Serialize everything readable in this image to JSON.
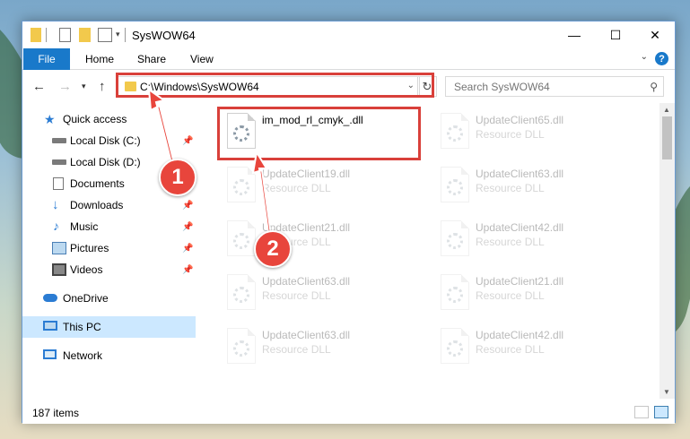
{
  "window": {
    "title": "SysWOW64",
    "controls": {
      "minimize": "—",
      "maximize": "☐",
      "close": "✕"
    }
  },
  "ribbon": {
    "tabs": [
      "File",
      "Home",
      "Share",
      "View"
    ],
    "help": "?"
  },
  "address_bar": {
    "path": "C:\\Windows\\SysWOW64"
  },
  "search": {
    "placeholder": "Search SysWOW64"
  },
  "sidebar": {
    "items": [
      {
        "label": "Quick access",
        "icon": "star-icon",
        "pinned": false
      },
      {
        "label": "Local Disk (C:)",
        "icon": "drive-icon",
        "pinned": true
      },
      {
        "label": "Local Disk (D:)",
        "icon": "drive-icon",
        "pinned": true
      },
      {
        "label": "Documents",
        "icon": "documents-icon",
        "pinned": true
      },
      {
        "label": "Downloads",
        "icon": "download-icon",
        "pinned": true
      },
      {
        "label": "Music",
        "icon": "music-icon",
        "pinned": true
      },
      {
        "label": "Pictures",
        "icon": "pictures-icon",
        "pinned": true
      },
      {
        "label": "Videos",
        "icon": "videos-icon",
        "pinned": true
      },
      {
        "label": "OneDrive",
        "icon": "cloud-icon",
        "pinned": false
      },
      {
        "label": "This PC",
        "icon": "computer-icon",
        "pinned": false,
        "selected": true
      },
      {
        "label": "Network",
        "icon": "network-icon",
        "pinned": false
      }
    ]
  },
  "files": [
    {
      "name": "im_mod_rl_cmyk_.dll",
      "type": "",
      "highlighted": true
    },
    {
      "name": "UpdateClient65.dll",
      "type": "Resource DLL"
    },
    {
      "name": "UpdateClient19.dll",
      "type": "Resource DLL"
    },
    {
      "name": "UpdateClient63.dll",
      "type": "Resource DLL"
    },
    {
      "name": "UpdateClient21.dll",
      "type": "Resource DLL"
    },
    {
      "name": "UpdateClient42.dll",
      "type": "Resource DLL"
    },
    {
      "name": "UpdateClient63.dll",
      "type": "Resource DLL"
    },
    {
      "name": "UpdateClient21.dll",
      "type": "Resource DLL"
    },
    {
      "name": "UpdateClient63.dll",
      "type": "Resource DLL"
    },
    {
      "name": "UpdateClient42.dll",
      "type": "Resource DLL"
    }
  ],
  "status": {
    "item_count": "187 items"
  },
  "annotations": {
    "step1": "1",
    "step2": "2",
    "color": "#e8453c"
  }
}
